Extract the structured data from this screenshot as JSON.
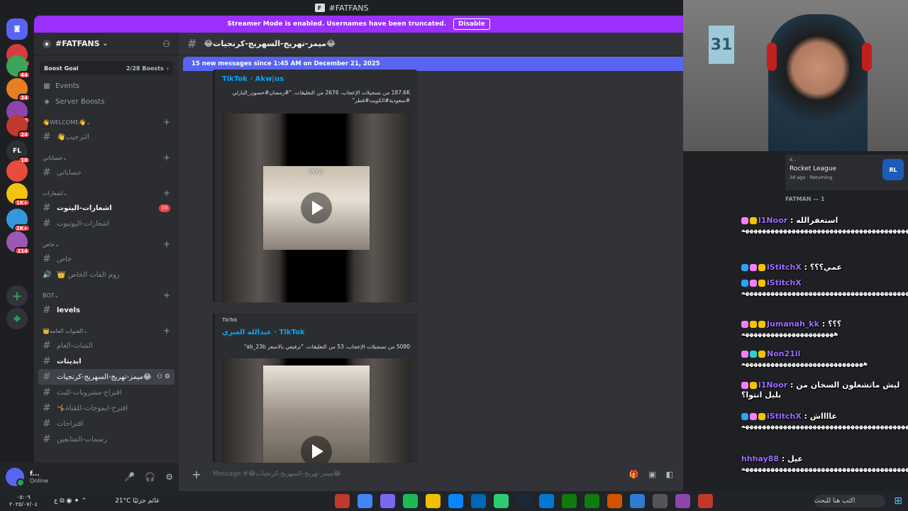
{
  "window": {
    "title": "#FATFANS"
  },
  "banner": {
    "text": "Streamer Mode is enabled. Usernames have been truncated.",
    "button": "Disable"
  },
  "rail": [
    {
      "glyph": "◙",
      "badge": ""
    },
    {
      "glyph": "",
      "badge": "2"
    },
    {
      "glyph": "",
      "badge": "44"
    },
    {
      "glyph": "",
      "badge": "24"
    },
    {
      "glyph": "",
      "badge": "3"
    },
    {
      "glyph": "",
      "badge": "24"
    },
    {
      "glyph": "FL",
      "badge": "10"
    },
    {
      "glyph": "",
      "badge": ""
    },
    {
      "glyph": "",
      "badge": "1K+"
    },
    {
      "glyph": "",
      "badge": "2K+"
    },
    {
      "glyph": "",
      "badge": "214"
    },
    {
      "glyph": "+",
      "badge": ""
    },
    {
      "glyph": "⌖",
      "badge": ""
    }
  ],
  "sidebar": {
    "server_name": "#FATFANS",
    "boost_goal": "Boost Goal",
    "boost_count": "2/28 Boosts",
    "nav": [
      {
        "icon": "calendar-icon",
        "label": "Events"
      },
      {
        "icon": "boost-icon",
        "label": "Server Boosts"
      }
    ],
    "categories": [
      {
        "name": "👋WELCOME👋",
        "channels": [
          {
            "name": "الترحيب👋",
            "type": "text",
            "state": "muted"
          }
        ]
      },
      {
        "name": "حساباتي",
        "channels": [
          {
            "name": "حساباتي",
            "type": "text",
            "state": "muted"
          }
        ]
      },
      {
        "name": "اشعارات",
        "channels": [
          {
            "name": "اشعارات-اليتوت",
            "type": "text",
            "state": "unread",
            "mention": "10"
          },
          {
            "name": "اشعارات-اليوتيوب",
            "type": "text",
            "state": "muted"
          }
        ]
      },
      {
        "name": "خاص",
        "channels": [
          {
            "name": "خاص",
            "type": "text",
            "state": "muted"
          },
          {
            "name": "روم الفات الخاص 👑",
            "type": "voice",
            "state": "muted"
          }
        ]
      },
      {
        "name": "BOT",
        "channels": [
          {
            "name": "levels",
            "type": "text",
            "state": "unread"
          }
        ]
      },
      {
        "name": "👑القنوات العامه",
        "channels": [
          {
            "name": "الشات-العام",
            "type": "text",
            "state": "muted"
          },
          {
            "name": "ابديتات",
            "type": "text",
            "state": "unread"
          },
          {
            "name": "😂ميمز-تهريج-السهريج-كرنجيات",
            "type": "text",
            "state": "active"
          },
          {
            "name": "اقتراح-مشروبات-للبث",
            "type": "text",
            "state": "muted"
          },
          {
            "name": "اقترح-ايموجات-للقناة🤸",
            "type": "text",
            "state": "muted"
          },
          {
            "name": "اقتراحات",
            "type": "text",
            "state": "muted"
          },
          {
            "name": "رسمات-المتابعين",
            "type": "text",
            "state": "muted"
          }
        ]
      }
    ]
  },
  "user": {
    "name": "f...",
    "status": "Online"
  },
  "main": {
    "channel": "😂ميمز-تهريج-السهريج-كرنجيات😂",
    "new_messages": "15 new messages since 1:45 AM on December 21, 2025",
    "embeds": [
      {
        "provider": "",
        "title": "TikTok · Akw|us",
        "desc": "187.6K من تسجيلات الإعجاب، 2676 من التعليقات. \"#رمضان#حسون_البارلي #سعودية#الكويت#قطر\""
      },
      {
        "provider": "TikTok",
        "title": "عبدالله العنزي · TikTok",
        "desc": "5080 من تسجيلات الإعجاب، 53 من التعليقات. \"ترفيعي بالاسفر ab_23b\""
      }
    ],
    "video_overlay": "POV:",
    "composer_placeholder": "Message #😂ميمز-تهريج-السهريج-كرنجيات😂"
  },
  "activity": {
    "user": "d...",
    "game": "Rocket League",
    "time": "3d ago · Returning",
    "members_header": "FATMAN — 1"
  },
  "stream_chat": [
    {
      "user": "l1Noor",
      "text": "استغفرالله",
      "body": "ههههههههههههههههههههههههههههههههههههههههه",
      "ico": [
        "#f47fff",
        "#f5c400"
      ]
    },
    {
      "user": "iStitchX",
      "text": "عمي؟؟؟",
      "body": "",
      "ico": [
        "#2aa4f4",
        "#f47fff",
        "#f5c400"
      ]
    },
    {
      "user": "iStitchX",
      "text": "",
      "body": "ههههههههههههههههههههههههههههههههههههههههههههه",
      "ico": [
        "#2aa4f4",
        "#f47fff",
        "#f5c400"
      ]
    },
    {
      "user": "Jumanah_kk",
      "text": "؟؟؟",
      "body": "ههههههههههههههههههههههه",
      "ico": [
        "#f47fff",
        "#f5c400",
        "#f5c400"
      ]
    },
    {
      "user": "Non21il",
      "text": "",
      "body": "هههههههههههههههههههههههههههههه",
      "ico": [
        "#f47fff",
        "#2bd2c8",
        "#f5c400"
      ]
    },
    {
      "user": "l1Noor",
      "text": "ليش ماتشغلون السخان من بليل انتوا؟",
      "body": "",
      "ico": [
        "#f47fff",
        "#f5c400"
      ]
    },
    {
      "user": "iStitchX",
      "text": "عااااش",
      "body": "هههههههههههههههههههههههههههههههههههههههههههههههه",
      "ico": [
        "#2aa4f4",
        "#f47fff",
        "#f5c400"
      ]
    },
    {
      "user": "hhhay88",
      "text": "عيل",
      "body": "هههههههههههههههههههههههههههههههههههههههههه",
      "ico": []
    }
  ],
  "taskbar": {
    "time": "٠٥:٠٩",
    "date": "٢٠٢٥/٠٧/٠٤",
    "weather": "21°C غائم جزئيًا",
    "search": "اكتب هنا للبحث"
  }
}
